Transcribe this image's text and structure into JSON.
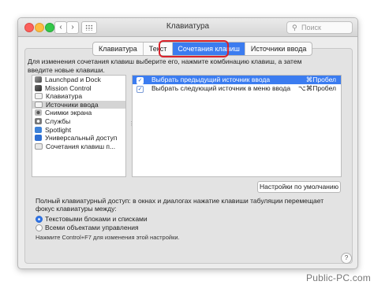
{
  "window": {
    "title": "Клавиатура",
    "search_placeholder": "Поиск",
    "search_icon": "magnifier",
    "nav_back": "‹",
    "nav_forward": "›"
  },
  "tabs": [
    {
      "label": "Клавиатура",
      "active": false
    },
    {
      "label": "Текст",
      "active": false
    },
    {
      "label": "Сочетания клавиш",
      "active": true
    },
    {
      "label": "Источники ввода",
      "active": false
    }
  ],
  "description": "Для изменения сочетания клавиш выберите его, нажмите комбинацию клавиш, а затем введите новые клавиши.",
  "categories": [
    {
      "label": "Launchpad и Dock",
      "icon": "launchpad-icon",
      "selected": false
    },
    {
      "label": "Mission Control",
      "icon": "mission-control-icon",
      "selected": false
    },
    {
      "label": "Клавиатура",
      "icon": "keyboard-icon",
      "selected": false
    },
    {
      "label": "Источники ввода",
      "icon": "input-sources-icon",
      "selected": true
    },
    {
      "label": "Снимки экрана",
      "icon": "screenshot-icon",
      "selected": false
    },
    {
      "label": "Службы",
      "icon": "gear-icon",
      "selected": false
    },
    {
      "label": "Spotlight",
      "icon": "spotlight-icon",
      "selected": false
    },
    {
      "label": "Универсальный доступ",
      "icon": "accessibility-icon",
      "selected": false
    },
    {
      "label": "Сочетания клавиш п...",
      "icon": "app-shortcuts-icon",
      "selected": false
    }
  ],
  "shortcuts": [
    {
      "checked": true,
      "label": "Выбрать предыдущий источник ввода",
      "keys": "⌘Пробел",
      "selected": true
    },
    {
      "checked": true,
      "label": "Выбрать следующий источник в меню ввода",
      "keys": "⌥⌘Пробел",
      "selected": false
    }
  ],
  "defaults_button": "Настройки по умолчанию",
  "keyboard_access": "Полный клавиатурный доступ: в окнах и диалогах нажатие клавиши табуляции перемещает фокус клавиатуры между:",
  "radio_options": [
    {
      "label": "Текстовыми блоками и списками",
      "selected": true
    },
    {
      "label": "Всеми объектами управления",
      "selected": false
    }
  ],
  "hint": "Нажмите Control+F7 для изменения этой настройки.",
  "help": "?",
  "watermark": "Public-PC.com",
  "colors": {
    "accent": "#3b7cf0",
    "highlight_border": "#d9232b",
    "close": "#fc605c",
    "minimize": "#fdbc40",
    "maximize": "#34c84a"
  }
}
